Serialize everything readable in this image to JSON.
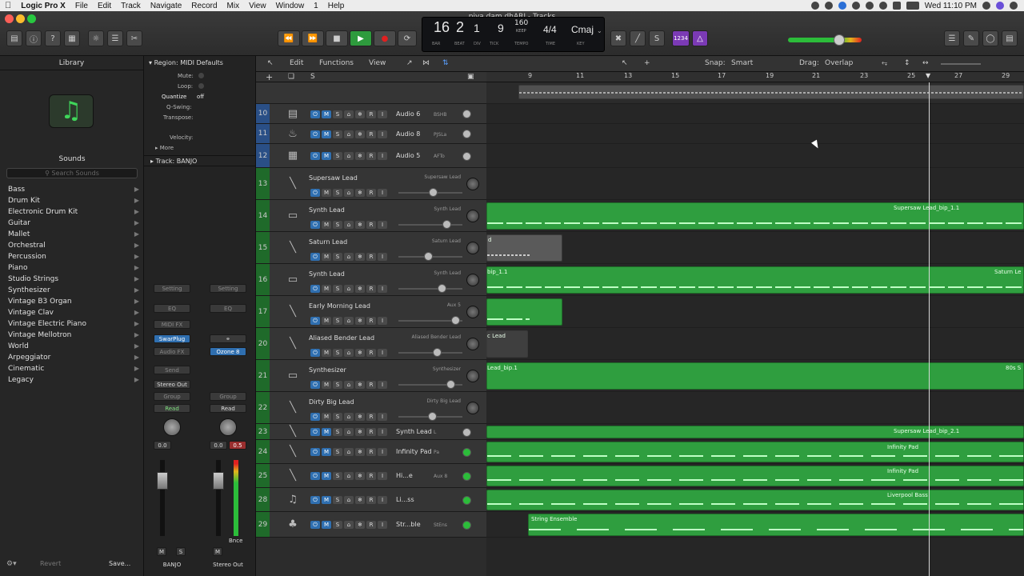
{
  "menubar": {
    "app": "Logic Pro X",
    "items": [
      "File",
      "Edit",
      "Track",
      "Navigate",
      "Record",
      "Mix",
      "View",
      "Window",
      "1",
      "Help"
    ],
    "clock": "Wed 11:10 PM"
  },
  "window": {
    "title": "piya dam dhARI - Tracks"
  },
  "transport": {
    "bar": "16",
    "beat": "2",
    "div": "1",
    "tick": "9",
    "tempo": "160",
    "tempo_mode": "KEEP",
    "signature": "4/4",
    "key": "Cmaj",
    "labels": {
      "bar": "BAR",
      "beat": "BEAT",
      "div": "DIV",
      "tick": "TICK",
      "tempo": "TEMPO",
      "time": "TIME",
      "key": "KEY"
    },
    "count_in": "1234"
  },
  "library": {
    "title": "Library",
    "sounds_label": "Sounds",
    "search_placeholder": "Search Sounds",
    "categories": [
      "Bass",
      "Drum Kit",
      "Electronic Drum Kit",
      "Guitar",
      "Mallet",
      "Orchestral",
      "Percussion",
      "Piano",
      "Studio Strings",
      "Synthesizer",
      "Vintage B3 Organ",
      "Vintage Clav",
      "Vintage Electric Piano",
      "Vintage Mellotron",
      "World",
      "Arpeggiator",
      "Cinematic",
      "Legacy"
    ]
  },
  "inspector": {
    "region_header": "Region: MIDI Defaults",
    "mute": "Mute:",
    "loop": "Loop:",
    "quantize": "Quantize",
    "quantize_value": "off",
    "qswing": "Q-Swing:",
    "transpose": "Transpose:",
    "velocity": "Velocity:",
    "more": "More",
    "track_header": "Track:",
    "track_name": "BANJO",
    "strip1": {
      "setting": "Setting",
      "eq": "EQ",
      "midifx": "MIDI FX",
      "plugin": "SwarPlug",
      "audiofx": "Audio FX",
      "send": "Send",
      "output": "Stereo Out",
      "group": "Group",
      "read": "Read",
      "vol": "0.0",
      "name": "BANJO",
      "m": "M",
      "s": "S"
    },
    "strip2": {
      "setting": "Setting",
      "eq": "EQ",
      "plugin": "Ozone 8",
      "group": "Group",
      "read": "Read",
      "vol": "0.0",
      "peak": "0.5",
      "name": "Stereo Out",
      "m": "M",
      "bnce": "Bnce"
    },
    "revert": "Revert",
    "save": "Save..."
  },
  "tracks_toolbar": {
    "edit": "Edit",
    "functions": "Functions",
    "view": "View",
    "snap_label": "Snap:",
    "snap_value": "Smart",
    "drag_label": "Drag:",
    "drag_value": "Overlap",
    "solo": "S"
  },
  "ruler": [
    "9",
    "11",
    "13",
    "15",
    "17",
    "19",
    "21",
    "23",
    "25",
    "27",
    "29"
  ],
  "tracks": [
    {
      "num": "10",
      "name": "Audio 6",
      "sub": "BSHB",
      "compact": true
    },
    {
      "num": "11",
      "name": "Audio 8",
      "sub": "PJSLa",
      "compact": true
    },
    {
      "num": "12",
      "name": "Audio 5",
      "sub": "AFTo",
      "compact": true
    },
    {
      "num": "13",
      "name": "Supersaw Lead",
      "sub": "Supersaw Lead"
    },
    {
      "num": "14",
      "name": "Synth Lead",
      "sub": "Synth Lead"
    },
    {
      "num": "15",
      "name": "Saturn Lead",
      "sub": "Saturn Lead"
    },
    {
      "num": "16",
      "name": "Synth Lead",
      "sub": "Synth Lead"
    },
    {
      "num": "17",
      "name": "Early Morning Lead",
      "sub": "Aux 5"
    },
    {
      "num": "20",
      "name": "Aliased Bender Lead",
      "sub": "Aliased Bender Lead"
    },
    {
      "num": "21",
      "name": "Synthesizer",
      "sub": "Synthesizer"
    },
    {
      "num": "22",
      "name": "Dirty Big Lead",
      "sub": "Dirty Big Lead"
    },
    {
      "num": "23",
      "name": "Synth Lead",
      "sub": "L",
      "compact": true
    },
    {
      "num": "24",
      "name": "Infinity Pad",
      "sub": "Pa",
      "compact": true
    },
    {
      "num": "25",
      "name": "Hi...e",
      "sub": "Aux 8",
      "compact": true
    },
    {
      "num": "28",
      "name": "Li...ss",
      "sub": "",
      "compact": true
    },
    {
      "num": "29",
      "name": "Str...ble",
      "sub": "StEns",
      "compact": true
    }
  ],
  "regions": [
    {
      "lane": "14",
      "label": "Supersaw Lead_bip_1.1"
    },
    {
      "lane": "15",
      "label": "d"
    },
    {
      "lane": "16",
      "label": "bip_1.1"
    },
    {
      "lane": "16b",
      "label": "Saturn Le"
    },
    {
      "lane": "20",
      "label": "c Lead"
    },
    {
      "lane": "21",
      "label": "Lead_bip.1"
    },
    {
      "lane": "21b",
      "label": "80s S"
    },
    {
      "lane": "23",
      "label": "Supersaw Lead_bip_2.1"
    },
    {
      "lane": "24",
      "label": "Infinity Pad"
    },
    {
      "lane": "25",
      "label": "Infinity Pad"
    },
    {
      "lane": "28",
      "label": "Liverpool Bass"
    },
    {
      "lane": "29",
      "label": "String Ensemble"
    }
  ]
}
